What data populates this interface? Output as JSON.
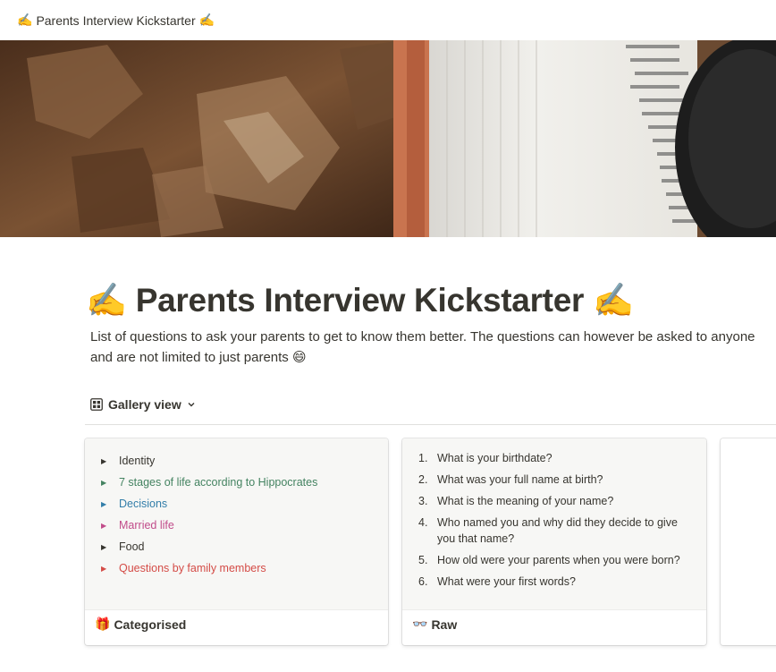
{
  "topbar": {
    "emoji": "✍️",
    "title": "Parents Interview Kickstarter",
    "emoji_end": "✍️"
  },
  "page": {
    "title_emoji": "✍️",
    "title": "Parents Interview Kickstarter",
    "title_emoji_end": "✍️",
    "description": "List of questions to ask your parents to get to know them better. The questions can however be asked to anyone and are not limited to just parents",
    "description_emoji": "😄"
  },
  "view": {
    "label": "Gallery view",
    "icon": "grid-icon"
  },
  "cards": [
    {
      "caption_emoji": "🎁",
      "caption": "Categorised",
      "items": [
        {
          "label": "Identity",
          "color": "#37352f"
        },
        {
          "label": "7 stages of life according to Hippocrates",
          "color": "#448361"
        },
        {
          "label": "Decisions",
          "color": "#337ea9"
        },
        {
          "label": "Married life",
          "color": "#c14c8a"
        },
        {
          "label": "Food",
          "color": "#37352f"
        },
        {
          "label": "Questions by family members",
          "color": "#d44c47"
        }
      ]
    },
    {
      "caption_emoji": "👓",
      "caption": "Raw",
      "items": [
        {
          "n": "1.",
          "text": "What is your birthdate?"
        },
        {
          "n": "2.",
          "text": "What was your full name at birth?"
        },
        {
          "n": "3.",
          "text": "What is the meaning of your name?"
        },
        {
          "n": "4.",
          "text": "Who named you and why did they decide to give you that name?"
        },
        {
          "n": "5.",
          "text": "How old were your parents when you were born?"
        },
        {
          "n": "6.",
          "text": "What were your first words?"
        }
      ]
    }
  ]
}
